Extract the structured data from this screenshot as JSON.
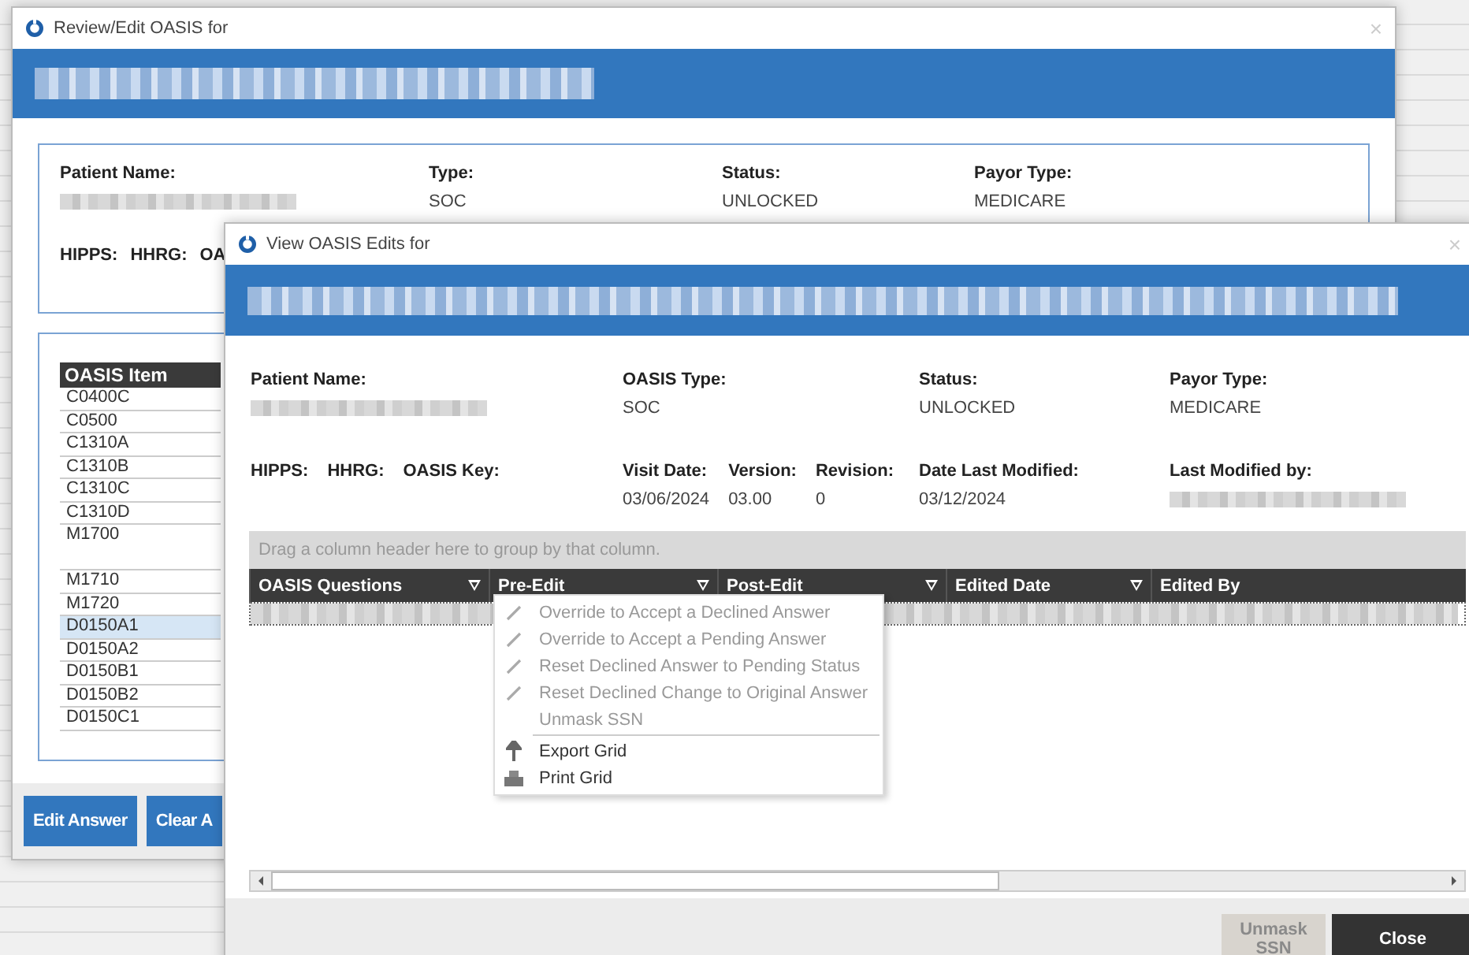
{
  "back_window": {
    "title": "Review/Edit OASIS for",
    "close": "×",
    "info": {
      "fields": [
        {
          "label": "Patient Name:"
        },
        {
          "label": "Type:",
          "value": "SOC"
        },
        {
          "label": "Status:",
          "value": "UNLOCKED"
        },
        {
          "label": "Payor Type:",
          "value": "MEDICARE"
        }
      ],
      "codes": [
        "HIPPS:",
        "HHRG:",
        "OA"
      ]
    },
    "item_list": {
      "header": "OASIS Item",
      "rows": [
        {
          "label": "C0400C",
          "selected": false,
          "kind": "single"
        },
        {
          "label": "C0500",
          "selected": false,
          "kind": "single"
        },
        {
          "label": "C1310A",
          "selected": false,
          "kind": "single"
        },
        {
          "label": "C1310B",
          "selected": false,
          "kind": "single"
        },
        {
          "label": "C1310C",
          "selected": false,
          "kind": "single"
        },
        {
          "label": "C1310D",
          "selected": false,
          "kind": "single"
        },
        {
          "label": "M1700",
          "selected": false,
          "kind": "double"
        },
        {
          "label": "M1710",
          "selected": false,
          "kind": "single"
        },
        {
          "label": "M1720",
          "selected": false,
          "kind": "single"
        },
        {
          "label": "D0150A1",
          "selected": true,
          "kind": "single"
        },
        {
          "label": "D0150A2",
          "selected": false,
          "kind": "single"
        },
        {
          "label": "D0150B1",
          "selected": false,
          "kind": "single"
        },
        {
          "label": "D0150B2",
          "selected": false,
          "kind": "single"
        },
        {
          "label": "D0150C1",
          "selected": false,
          "kind": "single"
        }
      ]
    },
    "buttons": [
      "Edit Answer",
      "Clear A"
    ]
  },
  "front_window": {
    "title": "View OASIS Edits for",
    "close": "×",
    "fields": [
      {
        "label": "Patient Name:"
      },
      {
        "label": "OASIS Type:",
        "value": "SOC"
      },
      {
        "label": "Status:",
        "value": "UNLOCKED"
      },
      {
        "label": "Payor Type:",
        "value": "MEDICARE"
      }
    ],
    "codes": [
      "HIPPS:",
      "HHRG:",
      "OASIS Key:"
    ],
    "visit": [
      {
        "label": "Visit Date:",
        "value": "03/06/2024"
      },
      {
        "label": "Version:",
        "value": "03.00"
      },
      {
        "label": "Revision:",
        "value": "0"
      }
    ],
    "modified": [
      {
        "label": "Date Last Modified:",
        "value": "03/12/2024"
      },
      {
        "label": "Last Modified by:"
      }
    ],
    "grid": {
      "group_hint": "Drag a column header here to group by that column.",
      "columns": [
        "OASIS Questions",
        "Pre-Edit",
        "Post-Edit",
        "Edited Date",
        "Edited By"
      ]
    },
    "context_menu": [
      {
        "label": "Override to Accept a Declined Answer",
        "kind": "pencil",
        "disabled": true
      },
      {
        "label": "Override to Accept a Pending Answer",
        "kind": "pencil",
        "disabled": true
      },
      {
        "label": "Reset Declined Answer to Pending Status",
        "kind": "pencil",
        "disabled": true
      },
      {
        "label": "Reset Declined Change to Original Answer",
        "kind": "pencil",
        "disabled": true
      },
      {
        "label": "Unmask SSN",
        "kind": "plain",
        "disabled": true
      },
      {
        "kind": "separator"
      },
      {
        "label": "Export Grid",
        "kind": "export",
        "disabled": false
      },
      {
        "label": "Print Grid",
        "kind": "print",
        "disabled": false
      }
    ],
    "buttons": [
      {
        "label": "Unmask SSN",
        "disabled": true
      },
      {
        "label": "Close",
        "disabled": false
      }
    ]
  }
}
